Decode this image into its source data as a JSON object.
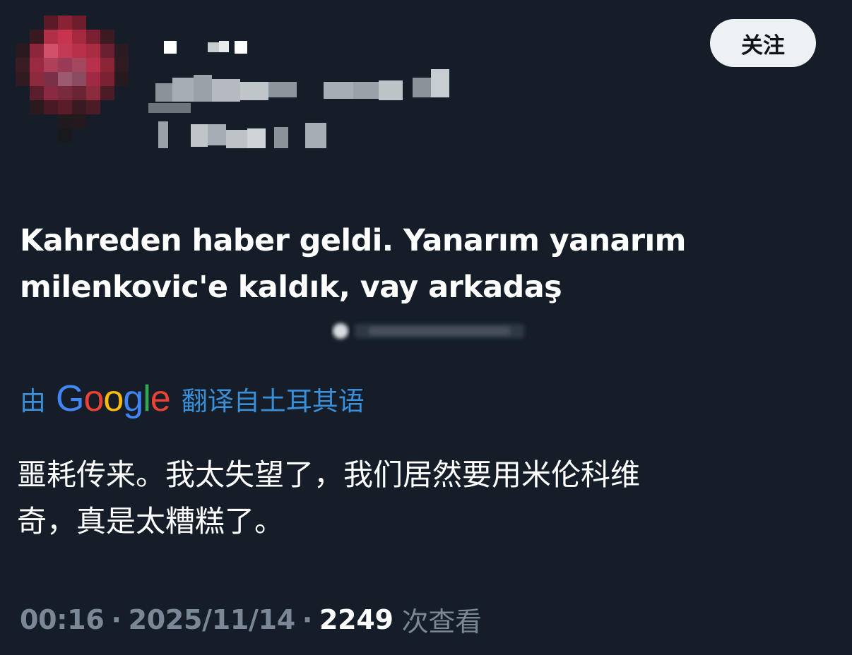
{
  "header": {
    "follow_label": "关注"
  },
  "tweet": {
    "text_line1": "Kahreden haber geldi. Yanarım yanarım",
    "text_line2": "milenkovic'e kaldık, vay arkadaş"
  },
  "translation": {
    "prefix": "由",
    "google_letters": [
      "G",
      "o",
      "o",
      "g",
      "l",
      "e"
    ],
    "suffix": "翻译自土耳其语",
    "text_line1": "噩耗传来。我太失望了，我们居然要用米伦科维",
    "text_line2": "奇，真是太糟糕了。"
  },
  "meta": {
    "time": "00:16",
    "separator": "·",
    "date": "2025/11/14",
    "views": "2249",
    "views_label": "次查看"
  },
  "colors": {
    "background": "#151d28",
    "accent": "#3a8fd9",
    "muted": "#7b8794",
    "google": [
      "#4285F4",
      "#EA4335",
      "#FBBC05",
      "#4285F4",
      "#34A853",
      "#EA4335"
    ]
  }
}
